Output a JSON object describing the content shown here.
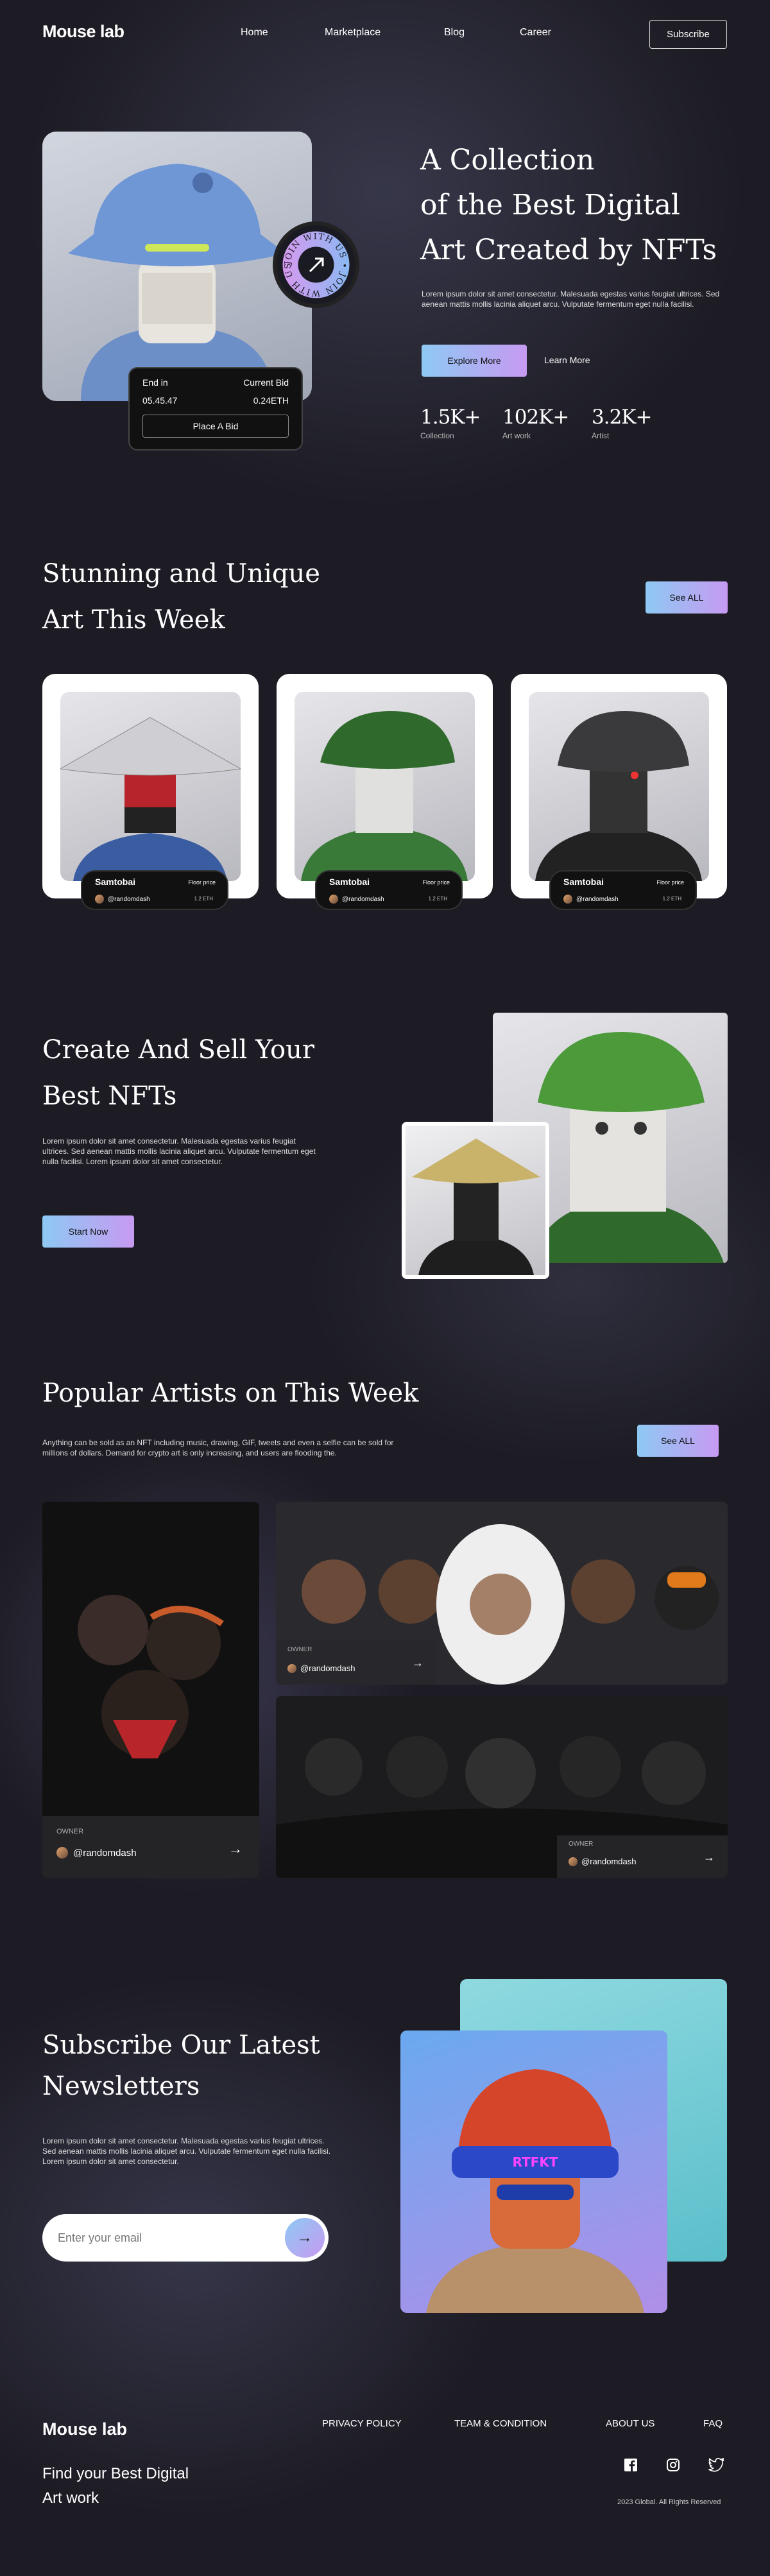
{
  "nav": {
    "logo": "Mouse lab",
    "links": [
      "Home",
      "Marketplace",
      "Blog",
      "Career"
    ],
    "subscribe": "Subscribe"
  },
  "hero": {
    "title_lines": [
      "A Collection",
      "of the Best Digital",
      "Art Created by NFTs"
    ],
    "desc": "Lorem ipsum dolor sit amet consectetur. Malesuada egestas varius feugiat ultrices. Sed aenean mattis mollis lacinia aliquet arcu. Vulputate fermentum eget nulla facilisi.",
    "explore": "Explore More",
    "learn": "Learn More",
    "stats": [
      {
        "value": "1.5K+",
        "label": "Collection"
      },
      {
        "value": "102K+",
        "label": "Art work"
      },
      {
        "value": "3.2K+",
        "label": "Artist"
      }
    ],
    "badge_text": "JOIN WITH US • JOIN WITH US •",
    "bid": {
      "end_label": "End in",
      "current_label": "Current Bid",
      "time": "05.45.47",
      "price": "0.24ETH",
      "button": "Place A Bid"
    }
  },
  "weekly": {
    "title_lines": [
      "Stunning and Unique",
      "Art This Week"
    ],
    "see_all": "See ALL",
    "cards": [
      {
        "name": "Samtobai",
        "floor_label": "Floor price",
        "user": "@randomdash",
        "price": "1.2 ETH"
      },
      {
        "name": "Samtobai",
        "floor_label": "Floor price",
        "user": "@randomdash",
        "price": "1.2 ETH"
      },
      {
        "name": "Samtobai",
        "floor_label": "Floor price",
        "user": "@randomdash",
        "price": "1.2 ETH"
      }
    ]
  },
  "create": {
    "title_lines": [
      "Create And Sell Your",
      "Best NFTs"
    ],
    "desc": "Lorem ipsum dolor sit amet consectetur. Malesuada egestas varius feugiat ultrices. Sed aenean mattis mollis lacinia aliquet arcu. Vulputate fermentum eget nulla facilisi. Lorem ipsum dolor sit amet consectetur.",
    "button": "Start Now"
  },
  "artists": {
    "title": "Popular Artists on This Week",
    "desc": "Anything can be sold as an NFT including music, drawing, GIF, tweets and even a selfie can be sold for millions of dollars. Demand for crypto art is only increasing, and users are flooding the.",
    "see_all": "See ALL",
    "owner_label": "OWNER",
    "owner": "@randomdash"
  },
  "newsletter": {
    "title_lines": [
      "Subscribe Our Latest",
      "Newsletters"
    ],
    "desc": "Lorem ipsum dolor sit amet consectetur. Malesuada egestas varius feugiat ultrices. Sed aenean mattis mollis lacinia aliquet arcu. Vulputate fermentum eget nulla facilisi. Lorem ipsum dolor sit amet consectetur.",
    "placeholder": "Enter your email",
    "helmet_text": "RTFKT"
  },
  "footer": {
    "logo": "Mouse lab",
    "tagline_lines": [
      "Find your Best Digital",
      "Art work"
    ],
    "links": [
      "PRIVACY POLICY",
      "TEAM & CONDITION",
      "ABOUT US",
      "FAQ"
    ],
    "copyright": "2023 Global. All Rights Reserved",
    "social_icons": [
      "facebook-icon",
      "instagram-icon",
      "twitter-icon"
    ]
  },
  "colors": {
    "accent_start": "#8ec9f3",
    "accent_end": "#c79af2",
    "bg": "#1d1c24"
  }
}
